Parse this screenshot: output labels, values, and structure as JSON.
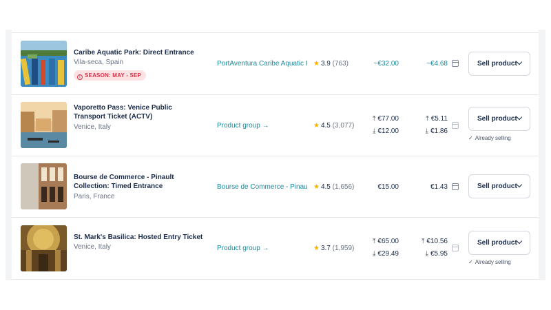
{
  "products": [
    {
      "title": "Caribe Aquatic Park: Direct Entrance",
      "location": "Vila-seca, Spain",
      "badge": "SEASON: MAY - SEP",
      "supplier": "PortAventura Caribe Aquatic Park",
      "rating": "3.9",
      "reviews": "(763)",
      "price": "~€32.00",
      "commission": "~€4.68",
      "button": "Sell product"
    },
    {
      "title": "Vaporetto Pass: Venice Public Transport Ticket (ACTV)",
      "location": "Venice, Italy",
      "supplier": "Product group",
      "rating": "4.5",
      "reviews": "(3,077)",
      "price_high": "€77.00",
      "price_low": "€12.00",
      "commission_high": "€5.11",
      "commission_low": "€1.86",
      "button": "Sell product",
      "status": "Already selling"
    },
    {
      "title": "Bourse de Commerce - Pinault Collection: Timed Entrance",
      "location": "Paris, France",
      "supplier": "Bourse de Commerce - Pinault Collection",
      "rating": "4.5",
      "reviews": "(1,656)",
      "price": "€15.00",
      "commission": "€1.43",
      "button": "Sell product"
    },
    {
      "title": "St. Mark's Basilica: Hosted Entry Ticket",
      "location": "Venice, Italy",
      "supplier": "Product group",
      "rating": "3.7",
      "reviews": "(1,959)",
      "price_high": "€65.00",
      "price_low": "€29.49",
      "commission_high": "€10.56",
      "commission_low": "€5.95",
      "button": "Sell product",
      "status": "Already selling"
    }
  ],
  "icons": {
    "star": "star-icon",
    "arrow_right": "arrow-right-icon",
    "arrow_up": "arrow-up-icon",
    "arrow_down": "arrow-down-icon",
    "calendar": "calendar-icon",
    "chevron": "chevron-down-icon",
    "check": "check-icon",
    "alert": "alert-circle-icon"
  },
  "colors": {
    "teal": "#1a8a9c",
    "season_bg": "#fde2e4",
    "season_text": "#d8334a",
    "star": "#f5b301",
    "text": "#1a2b49"
  }
}
